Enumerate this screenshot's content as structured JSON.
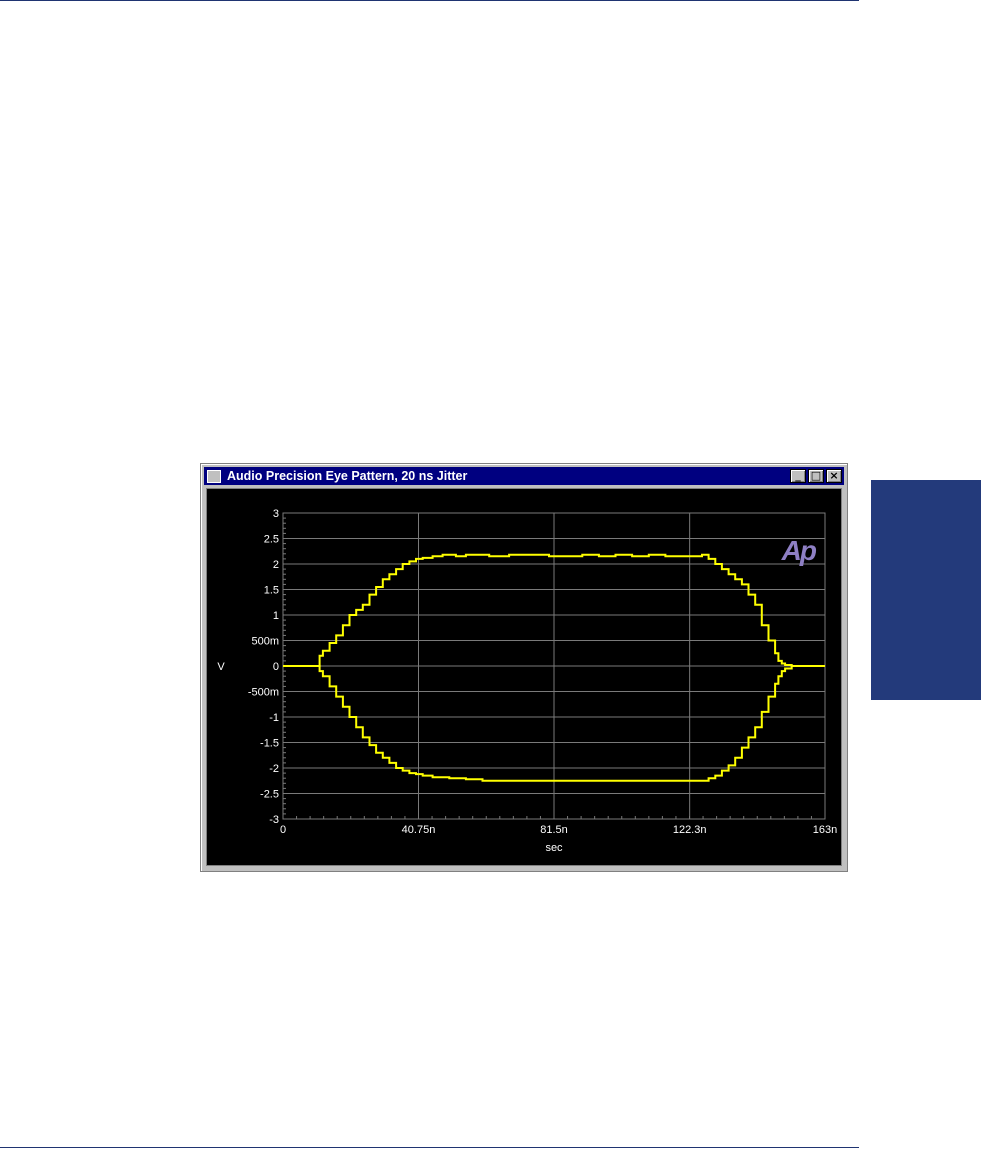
{
  "window": {
    "title": "Audio Precision  Eye Pattern, 20 ns Jitter",
    "controls": [
      "_",
      "□",
      "×"
    ],
    "logo_text": "Ap"
  },
  "colors": {
    "rule": "#1f3471",
    "side_tab": "#233a7b",
    "trace": "#ffff00",
    "grid": "#7a7a7a",
    "axis_text": "#ffffff",
    "logo": "#8e7fc4"
  },
  "chart_data": {
    "type": "line",
    "title": "Eye Pattern, 20 ns Jitter",
    "xlabel": "sec",
    "ylabel": "V",
    "xlim": [
      0,
      163
    ],
    "ylim": [
      -3,
      3
    ],
    "x_ticks": [
      0,
      40.75,
      81.5,
      122.3,
      163
    ],
    "x_tick_labels": [
      "0",
      "40.75n",
      "81.5n",
      "122.3n",
      "163n"
    ],
    "y_ticks": [
      3,
      2.5,
      2,
      1.5,
      1,
      0.5,
      0,
      -0.5,
      -1,
      -1.5,
      -2,
      -2.5,
      -3
    ],
    "y_tick_labels": [
      "3",
      "2.5",
      "2",
      "1.5",
      "1",
      "500m",
      "0",
      "-500m",
      "-1",
      "-1.5",
      "-2",
      "-2.5",
      "-3"
    ],
    "grid": true,
    "series": [
      {
        "x": [
          0,
          10,
          11,
          12,
          14,
          16,
          18,
          20,
          22,
          24,
          26,
          28,
          30,
          32,
          34,
          36,
          38,
          40,
          42,
          45,
          48,
          52,
          55,
          58,
          62,
          68,
          72,
          80,
          85,
          90,
          95,
          100,
          105,
          110,
          115,
          120,
          126,
          128,
          130,
          132,
          134,
          136,
          138,
          140,
          142,
          144,
          146,
          148,
          149,
          150,
          151,
          153,
          163
        ],
        "y": [
          0,
          0,
          0.2,
          0.3,
          0.45,
          0.6,
          0.8,
          1.0,
          1.1,
          1.2,
          1.4,
          1.55,
          1.7,
          1.8,
          1.9,
          2.0,
          2.05,
          2.1,
          2.12,
          2.15,
          2.18,
          2.15,
          2.18,
          2.18,
          2.15,
          2.18,
          2.18,
          2.15,
          2.15,
          2.18,
          2.15,
          2.18,
          2.15,
          2.18,
          2.15,
          2.15,
          2.18,
          2.1,
          2.0,
          1.9,
          1.8,
          1.7,
          1.6,
          1.4,
          1.2,
          0.8,
          0.5,
          0.25,
          0.1,
          0.05,
          0.02,
          0,
          0
        ]
      },
      {
        "x": [
          0,
          10,
          11,
          12,
          14,
          16,
          18,
          20,
          22,
          24,
          26,
          28,
          30,
          32,
          34,
          36,
          38,
          40,
          42,
          45,
          50,
          55,
          60,
          80,
          100,
          120,
          126,
          128,
          130,
          132,
          134,
          136,
          138,
          140,
          142,
          144,
          146,
          148,
          149,
          150,
          151,
          153,
          163
        ],
        "y": [
          0,
          0,
          -0.1,
          -0.2,
          -0.4,
          -0.6,
          -0.8,
          -1.0,
          -1.2,
          -1.4,
          -1.55,
          -1.7,
          -1.8,
          -1.9,
          -2.0,
          -2.05,
          -2.1,
          -2.12,
          -2.15,
          -2.18,
          -2.2,
          -2.22,
          -2.25,
          -2.25,
          -2.25,
          -2.25,
          -2.25,
          -2.2,
          -2.15,
          -2.05,
          -1.95,
          -1.8,
          -1.6,
          -1.4,
          -1.2,
          -0.9,
          -0.6,
          -0.35,
          -0.2,
          -0.1,
          -0.05,
          0,
          0
        ]
      }
    ]
  }
}
